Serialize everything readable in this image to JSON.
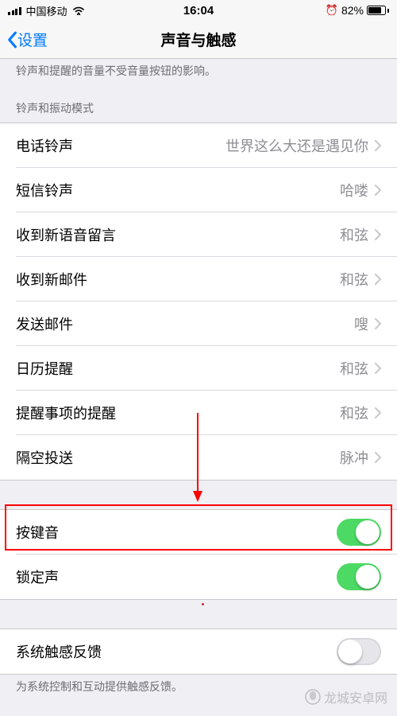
{
  "status": {
    "carrier": "中国移动",
    "time": "16:04",
    "battery": "82%",
    "alarm": "⏰"
  },
  "nav": {
    "back": "设置",
    "title": "声音与触感"
  },
  "helper_top": "铃声和提醒的音量不受音量按钮的影响。",
  "section_header": "铃声和振动模式",
  "rows": [
    {
      "label": "电话铃声",
      "value": "世界这么大还是遇见你"
    },
    {
      "label": "短信铃声",
      "value": "哈喽"
    },
    {
      "label": "收到新语音留言",
      "value": "和弦"
    },
    {
      "label": "收到新邮件",
      "value": "和弦"
    },
    {
      "label": "发送邮件",
      "value": "嗖"
    },
    {
      "label": "日历提醒",
      "value": "和弦"
    },
    {
      "label": "提醒事项的提醒",
      "value": "和弦"
    },
    {
      "label": "隔空投送",
      "value": "脉冲"
    }
  ],
  "toggles": [
    {
      "label": "按键音",
      "on": true
    },
    {
      "label": "锁定声",
      "on": true
    }
  ],
  "haptic": {
    "label": "系统触感反馈",
    "on": false
  },
  "helper_bottom": "为系统控制和互动提供触感反馈。",
  "watermark": "龙城安卓网",
  "annotation": {
    "red_box": true
  }
}
